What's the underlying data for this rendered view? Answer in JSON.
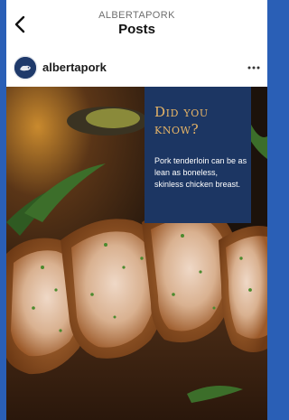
{
  "header": {
    "subtitle": "ALBERTAPORK",
    "title": "Posts",
    "back_icon": "chevron-left-icon"
  },
  "post": {
    "username": "albertapork",
    "avatar_icon": "albertapork-logo",
    "more_icon": "ellipsis-horizontal-icon",
    "image_description_icon": "sliced-pork-tenderloin-photo",
    "card": {
      "heading": "Did you know?",
      "body": "Pork tenderloin can be as lean as boneless, skinless chicken breast.",
      "background_color": "#1c3663",
      "heading_color": "#e8b566"
    }
  },
  "colors": {
    "frame_background": "#2a5fb6",
    "screen_background": "#ffffff"
  }
}
